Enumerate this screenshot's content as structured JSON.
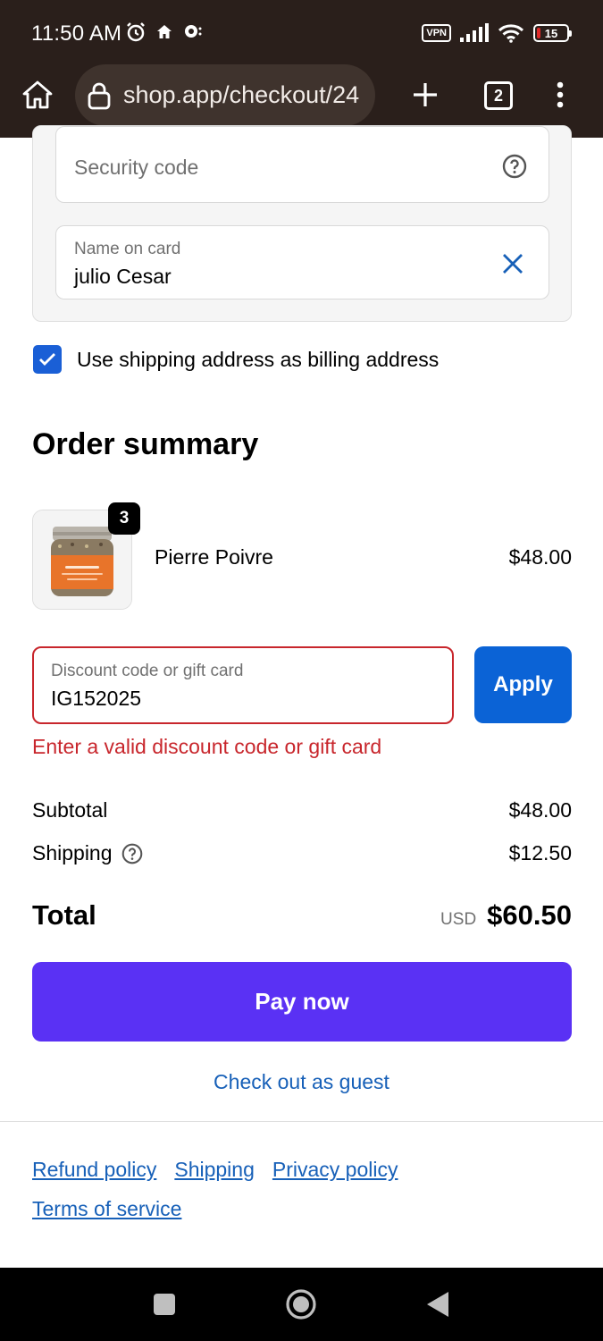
{
  "status_bar": {
    "time": "11:50 AM",
    "vpn": "VPN",
    "battery": "15"
  },
  "browser": {
    "url": "shop.app/checkout/24",
    "tab_count": "2"
  },
  "payment": {
    "security_code_placeholder": "Security code",
    "name_label": "Name on card",
    "name_value": "julio Cesar"
  },
  "billing": {
    "checked": true,
    "label": "Use shipping address as billing address"
  },
  "order_summary": {
    "title": "Order summary",
    "item": {
      "name": "Pierre Poivre",
      "price": "$48.00",
      "quantity": "3"
    }
  },
  "discount": {
    "label": "Discount code or gift card",
    "value": "IG152025",
    "apply_label": "Apply",
    "error": "Enter a valid discount code or gift card"
  },
  "totals": {
    "subtotal_label": "Subtotal",
    "subtotal_value": "$48.00",
    "shipping_label": "Shipping",
    "shipping_value": "$12.50",
    "total_label": "Total",
    "currency": "USD",
    "total_value": "$60.50"
  },
  "actions": {
    "pay_now": "Pay now",
    "guest_checkout": "Check out as guest"
  },
  "footer": {
    "links": [
      "Refund policy",
      "Shipping",
      "Privacy policy",
      "Terms of service"
    ]
  },
  "colors": {
    "primary_pay": "#5a31f4",
    "apply_blue": "#0b63d6",
    "error_red": "#c8262c",
    "link_blue": "#1760b8",
    "browser_chrome": "#2a1f1b"
  }
}
